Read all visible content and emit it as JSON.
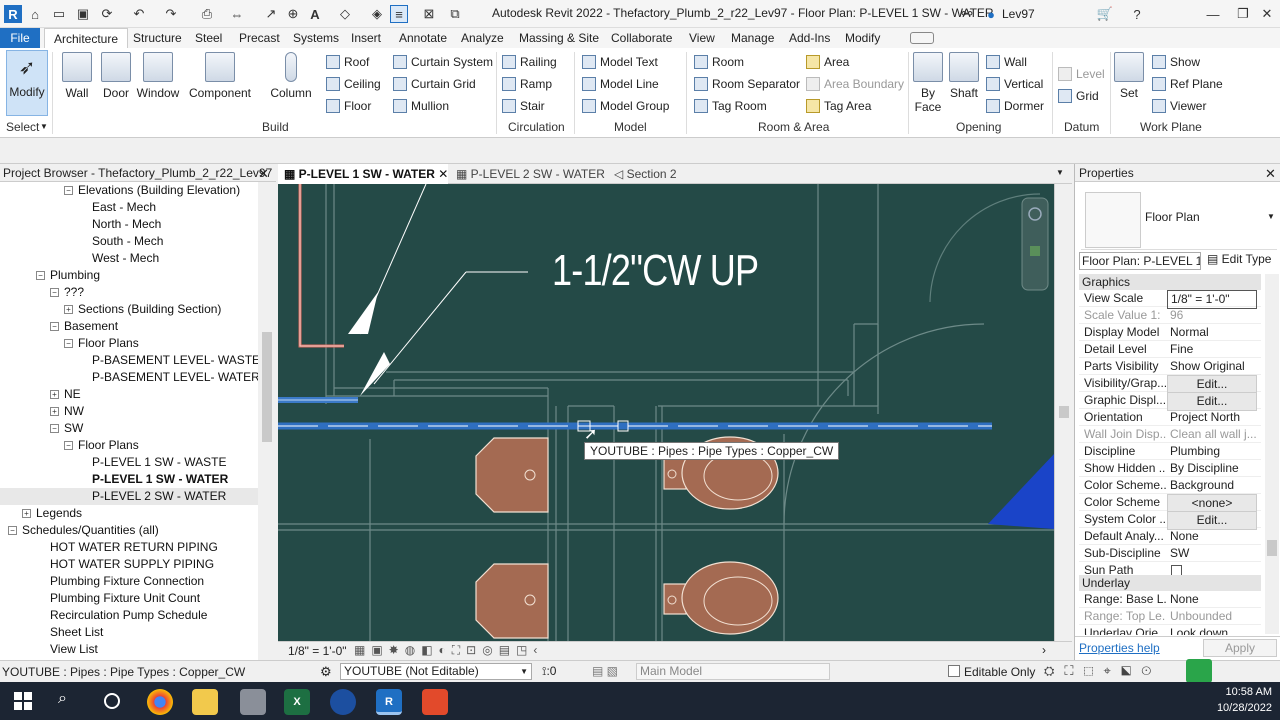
{
  "app": {
    "title": "Autodesk Revit 2022 - Thefactory_Plumb_2_r22_Lev97 - Floor Plan: P-LEVEL 1 SW - WATER",
    "user": "Lev97"
  },
  "ribbon_tabs": [
    "File",
    "Architecture",
    "Structure",
    "Steel",
    "Precast",
    "Systems",
    "Insert",
    "Annotate",
    "Analyze",
    "Massing & Site",
    "Collaborate",
    "View",
    "Manage",
    "Add-Ins",
    "Modify"
  ],
  "ribbon": {
    "select": {
      "modify": "Modify",
      "panel": "Select"
    },
    "build": {
      "panel": "Build",
      "big": [
        "Wall",
        "Door",
        "Window",
        "Component",
        "Column"
      ],
      "small": [
        "Roof",
        "Ceiling",
        "Floor",
        "Curtain System",
        "Curtain Grid",
        "Mullion"
      ]
    },
    "circulation": {
      "panel": "Circulation",
      "items": [
        "Railing",
        "Ramp",
        "Stair"
      ]
    },
    "model": {
      "panel": "Model",
      "items": [
        "Model Text",
        "Model Line",
        "Model Group"
      ]
    },
    "room": {
      "panel": "Room & Area",
      "items": [
        "Room",
        "Room Separator",
        "Tag Room",
        "Area",
        "Area Boundary",
        "Tag Area"
      ]
    },
    "opening": {
      "panel": "Opening",
      "big": [
        "By Face",
        "Shaft"
      ],
      "small": [
        "Wall",
        "Vertical",
        "Dormer"
      ]
    },
    "datum": {
      "panel": "Datum",
      "items": [
        "Level",
        "Grid"
      ]
    },
    "workplane": {
      "panel": "Work Plane",
      "set": "Set",
      "items": [
        "Show",
        "Ref Plane",
        "Viewer"
      ]
    }
  },
  "browser": {
    "title": "Project Browser - Thefactory_Plumb_2_r22_Lev97",
    "items": [
      {
        "label": "Elevations (Building Elevation)",
        "indent": 4,
        "tw": "−"
      },
      {
        "label": "East - Mech",
        "indent": 6
      },
      {
        "label": "North - Mech",
        "indent": 6
      },
      {
        "label": "South - Mech",
        "indent": 6
      },
      {
        "label": "West - Mech",
        "indent": 6
      },
      {
        "label": "Plumbing",
        "indent": 2,
        "tw": "−"
      },
      {
        "label": "???",
        "indent": 3,
        "tw": "−"
      },
      {
        "label": "Sections (Building Section)",
        "indent": 4,
        "tw": "+"
      },
      {
        "label": "Basement",
        "indent": 3,
        "tw": "−"
      },
      {
        "label": "Floor Plans",
        "indent": 4,
        "tw": "−"
      },
      {
        "label": "P-BASEMENT LEVEL- WASTE",
        "indent": 6
      },
      {
        "label": "P-BASEMENT LEVEL- WATER",
        "indent": 6
      },
      {
        "label": "NE",
        "indent": 3,
        "tw": "+"
      },
      {
        "label": "NW",
        "indent": 3,
        "tw": "+"
      },
      {
        "label": "SW",
        "indent": 3,
        "tw": "−"
      },
      {
        "label": "Floor Plans",
        "indent": 4,
        "tw": "−"
      },
      {
        "label": "P-LEVEL 1 SW - WASTE",
        "indent": 6
      },
      {
        "label": "P-LEVEL 1 SW - WATER",
        "indent": 6,
        "bold": true
      },
      {
        "label": "P-LEVEL 2 SW - WATER",
        "indent": 6,
        "sel": true
      },
      {
        "label": "Legends",
        "indent": 1,
        "tw": "+"
      },
      {
        "label": "Schedules/Quantities (all)",
        "indent": 0,
        "tw": "−"
      },
      {
        "label": "HOT WATER RETURN PIPING",
        "indent": 3
      },
      {
        "label": "HOT WATER SUPPLY PIPING",
        "indent": 3
      },
      {
        "label": "Plumbing Fixture Connection",
        "indent": 3
      },
      {
        "label": "Plumbing Fixture Unit Count",
        "indent": 3
      },
      {
        "label": "Recirculation Pump Schedule",
        "indent": 3
      },
      {
        "label": "Sheet List",
        "indent": 3
      },
      {
        "label": "View List",
        "indent": 3
      }
    ]
  },
  "view_tabs": [
    "P-LEVEL 1 SW - WATER",
    "P-LEVEL 2 SW - WATER",
    "Section 2"
  ],
  "canvas": {
    "annotation": "1-1/2\"CW UP",
    "tooltip": "YOUTUBE : Pipes : Pipe Types : Copper_CW"
  },
  "viewbar": {
    "scale": "1/8\" = 1'-0\""
  },
  "properties": {
    "title": "Properties",
    "type": "Floor Plan",
    "selector": "Floor Plan: P-LEVEL 1",
    "edit_type": "Edit Type",
    "graphics_header": "Graphics",
    "rows": [
      {
        "k": "View Scale",
        "v": "1/8\" = 1'-0\""
      },
      {
        "k": "Scale Value 1:",
        "v": "96",
        "dis": true
      },
      {
        "k": "Display Model",
        "v": "Normal"
      },
      {
        "k": "Detail Level",
        "v": "Fine"
      },
      {
        "k": "Parts Visibility",
        "v": "Show Original"
      },
      {
        "k": "Visibility/Grap...",
        "v": "Edit...",
        "btn": true
      },
      {
        "k": "Graphic Displ...",
        "v": "Edit...",
        "btn": true
      },
      {
        "k": "Orientation",
        "v": "Project North"
      },
      {
        "k": "Wall Join Disp...",
        "v": "Clean all wall j...",
        "dis": true
      },
      {
        "k": "Discipline",
        "v": "Plumbing"
      },
      {
        "k": "Show Hidden ...",
        "v": "By Discipline"
      },
      {
        "k": "Color Scheme...",
        "v": "Background"
      },
      {
        "k": "Color Scheme",
        "v": "<none>",
        "btn": true
      },
      {
        "k": "System Color ...",
        "v": "Edit...",
        "btn": true
      },
      {
        "k": "Default Analy...",
        "v": "None"
      },
      {
        "k": "Sub-Discipline",
        "v": "SW"
      },
      {
        "k": "Sun Path",
        "v": ""
      }
    ],
    "underlay_header": "Underlay",
    "underlay_rows": [
      {
        "k": "Range: Base L...",
        "v": "None"
      },
      {
        "k": "Range: Top Le...",
        "v": "Unbounded",
        "dis": true
      },
      {
        "k": "Underlay Orie...",
        "v": "Look down"
      }
    ],
    "help": "Properties help",
    "apply": "Apply"
  },
  "status": {
    "text": "YOUTUBE : Pipes : Pipe Types : Copper_CW",
    "workset": "YOUTUBE (Not Editable)",
    "count": ":0",
    "model": "Main Model",
    "editable_only": "Editable Only"
  },
  "taskbar": {
    "time": "10:58 AM",
    "date": "10/28/2022"
  },
  "colors": {
    "canvas": "#244a47",
    "pipe": "#2f6fc0",
    "accent": "#1f6fc3"
  }
}
